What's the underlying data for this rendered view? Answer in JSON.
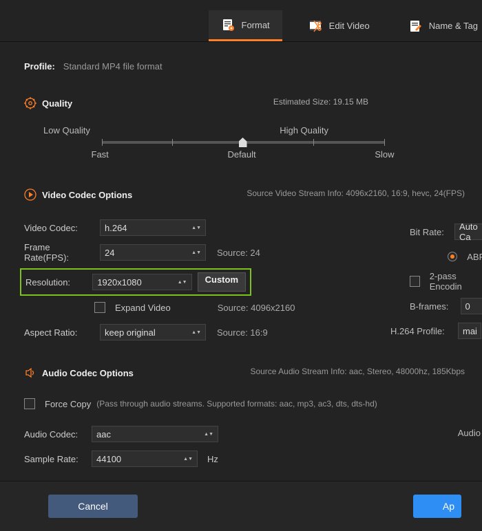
{
  "tabs": {
    "format": "Format",
    "edit_video": "Edit Video",
    "name_tag": "Name & Tag"
  },
  "profile": {
    "label": "Profile:",
    "value": "Standard MP4 file format"
  },
  "quality": {
    "heading": "Quality",
    "estimated": "Estimated Size: 19.15 MB",
    "low": "Low Quality",
    "high": "High Quality",
    "fast": "Fast",
    "default": "Default",
    "slow": "Slow"
  },
  "vcodec": {
    "heading": "Video Codec Options",
    "src_info": "Source Video Stream Info: 4096x2160, 16:9, hevc, 24(FPS)",
    "video_codec_label": "Video Codec:",
    "video_codec_value": "h.264",
    "frame_rate_label": "Frame Rate(FPS):",
    "frame_rate_value": "24",
    "frame_rate_source": "Source: 24",
    "resolution_label": "Resolution:",
    "resolution_value": "1920x1080",
    "resolution_custom": "Custom",
    "resolution_source": "Source: 4096x2160",
    "expand_video": "Expand Video",
    "aspect_label": "Aspect Ratio:",
    "aspect_value": "keep original",
    "aspect_source": "Source: 16:9",
    "bitrate_label": "Bit Rate:",
    "bitrate_value": "Auto Ca",
    "abr": "ABR",
    "twopass": "2-pass Encodin",
    "bframes_label": "B-frames:",
    "bframes_value": "0",
    "profile_label": "H.264 Profile:",
    "profile_value": "mai"
  },
  "acodec": {
    "heading": "Audio Codec Options",
    "src_info": "Source Audio Stream Info: aac, Stereo, 48000hz, 185Kbps",
    "force_copy": "Force Copy",
    "force_copy_hint": "(Pass through audio streams. Supported formats: aac, mp3, ac3, dts, dts-hd)",
    "audio_codec_label": "Audio Codec:",
    "audio_codec_value": "aac",
    "audio_bitrate_label": "Audio",
    "sample_rate_label": "Sample Rate:",
    "sample_rate_value": "44100",
    "hz": "Hz"
  },
  "buttons": {
    "cancel": "Cancel",
    "apply": "Ap"
  }
}
